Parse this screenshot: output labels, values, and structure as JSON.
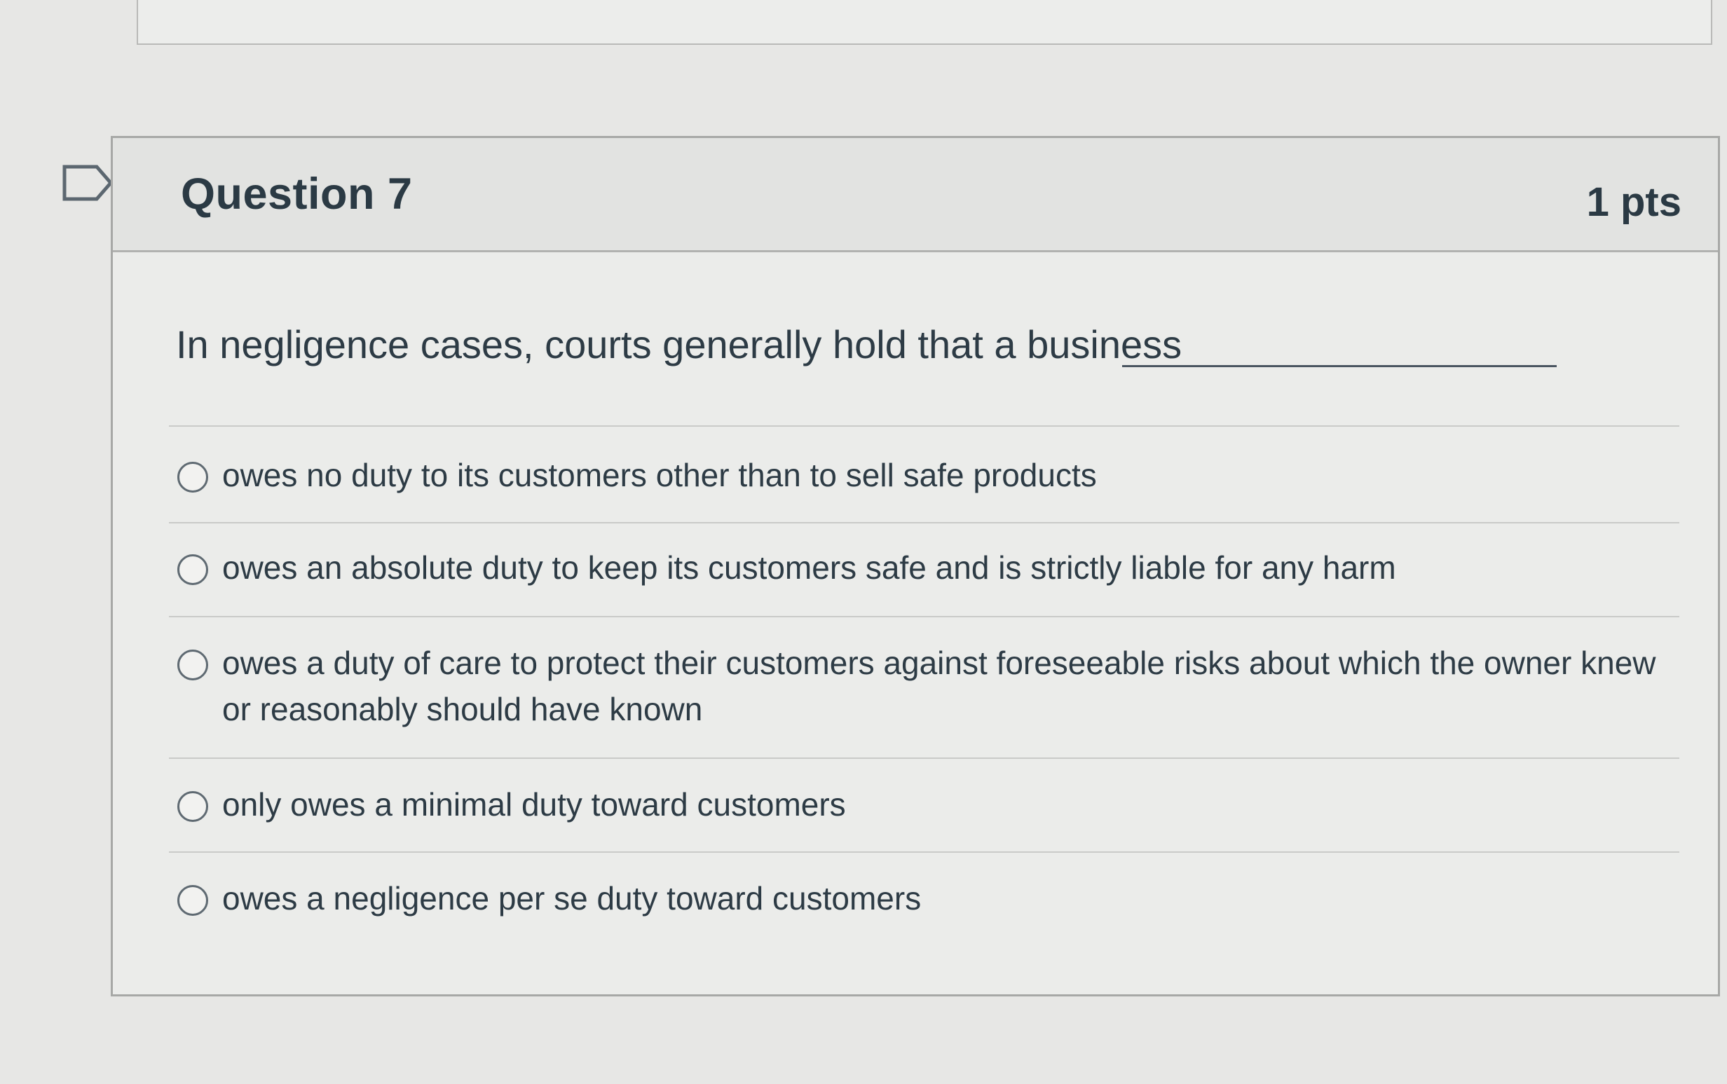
{
  "question": {
    "title": "Question 7",
    "points": "1 pts",
    "text": "In negligence cases, courts generally hold that a business",
    "answers": [
      "owes no duty to its customers other than to sell safe products",
      "owes an absolute duty to keep its customers safe and is strictly liable for any harm",
      "owes a duty of care to protect their customers against foreseeable risks about which the owner knew or reasonably should have known",
      "only owes a minimal duty toward customers",
      "owes a negligence per se duty toward customers"
    ]
  },
  "icons": {
    "flag": "flag-outline-icon",
    "radio": "radio-unselected-icon"
  },
  "colors": {
    "text": "#2d3b45",
    "border": "#a7a8a6",
    "header_bg": "#e2e3e1"
  }
}
